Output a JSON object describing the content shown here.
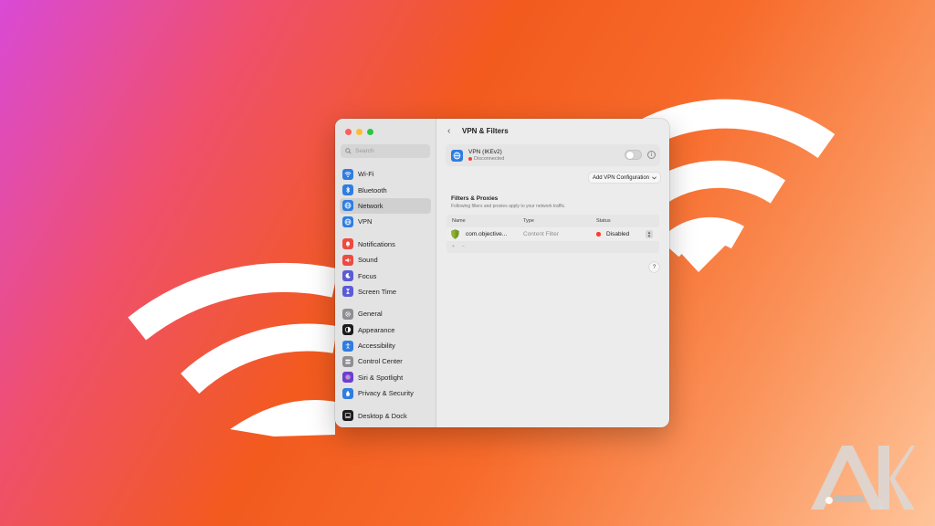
{
  "window": {
    "title": "VPN & Filters"
  },
  "sidebar": {
    "search_placeholder": "Search",
    "groups": [
      [
        {
          "label": "Wi-Fi",
          "icon": "wifi-icon",
          "color": "#2f7de1"
        },
        {
          "label": "Bluetooth",
          "icon": "bluetooth-icon",
          "color": "#2f7de1"
        },
        {
          "label": "Network",
          "icon": "globe-icon",
          "color": "#2f7de1",
          "active": true
        },
        {
          "label": "VPN",
          "icon": "vpn-globe-icon",
          "color": "#2f7de1"
        }
      ],
      [
        {
          "label": "Notifications",
          "icon": "bell-icon",
          "color": "#ef4a3f"
        },
        {
          "label": "Sound",
          "icon": "speaker-icon",
          "color": "#ef4a3f"
        },
        {
          "label": "Focus",
          "icon": "moon-icon",
          "color": "#5b5bd6"
        },
        {
          "label": "Screen Time",
          "icon": "hourglass-icon",
          "color": "#5b5bd6"
        }
      ],
      [
        {
          "label": "General",
          "icon": "gear-icon",
          "color": "#8e8e93"
        },
        {
          "label": "Appearance",
          "icon": "appearance-icon",
          "color": "#1c1c1e"
        },
        {
          "label": "Accessibility",
          "icon": "accessibility-icon",
          "color": "#2f7de1"
        },
        {
          "label": "Control Center",
          "icon": "control-center-icon",
          "color": "#8e8e93"
        },
        {
          "label": "Siri & Spotlight",
          "icon": "siri-icon",
          "color": "#6b3fd1"
        },
        {
          "label": "Privacy & Security",
          "icon": "hand-icon",
          "color": "#2f7de1"
        }
      ],
      [
        {
          "label": "Desktop & Dock",
          "icon": "dock-icon",
          "color": "#1c1c1e"
        }
      ]
    ]
  },
  "vpn": {
    "name": "VPN (IKEv2)",
    "status": "Disconnected",
    "add_button": "Add VPN Configuration"
  },
  "filters": {
    "title": "Filters & Proxies",
    "subtitle": "Following filters and proxies apply to your network traffic.",
    "columns": [
      "Name",
      "Type",
      "Status"
    ],
    "rows": [
      {
        "name": "com.objective...",
        "type": "Content Filter",
        "status": "Disabled"
      }
    ],
    "add_symbol": "+",
    "remove_symbol": "–"
  },
  "help_label": "?",
  "logo_text": "AK",
  "colors": {
    "window_bg": "#ececec",
    "sidebar_bg": "#e3e3e3",
    "accent": "#2f7de1",
    "status_red": "#ff3b30"
  }
}
